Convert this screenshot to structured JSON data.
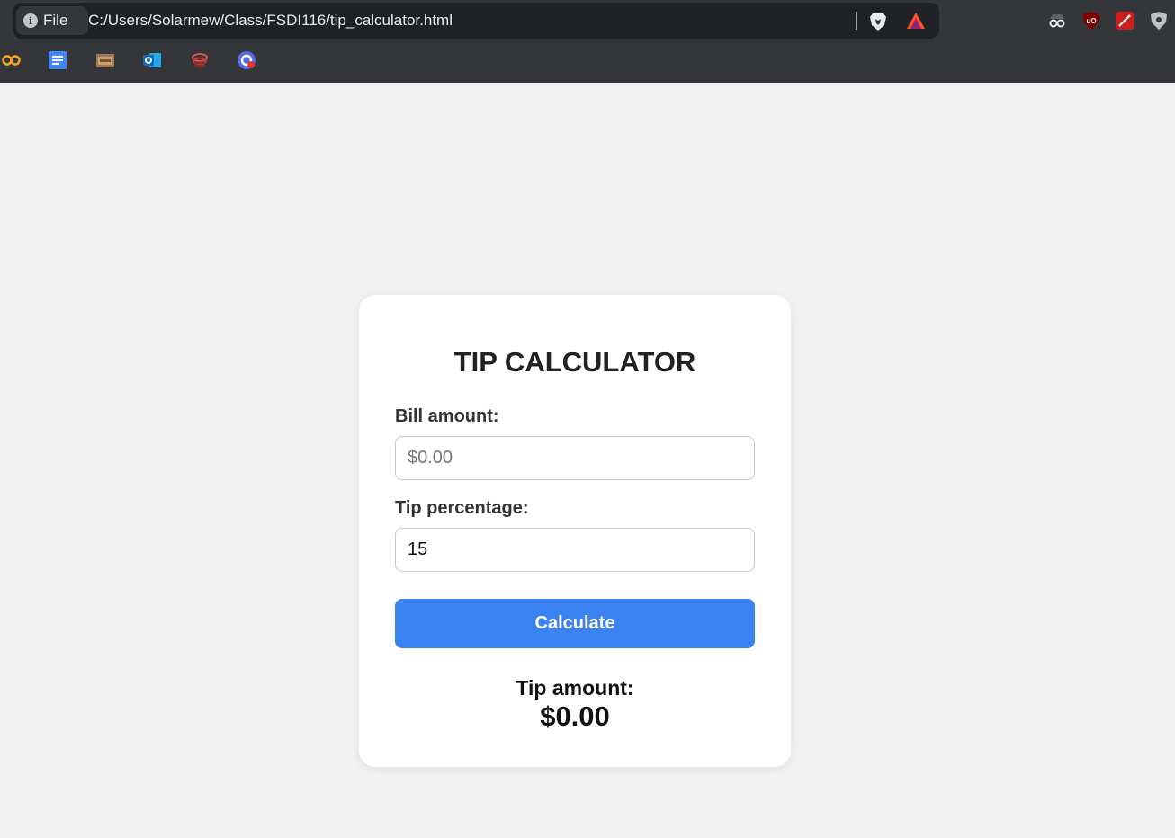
{
  "browser": {
    "site_chip_label": "File",
    "url": "C:/Users/Solarmew/Class/FSDI116/tip_calculator.html",
    "bookmarks": [
      "coursera-icon",
      "google-docs-icon",
      "lego-icon",
      "outlook-icon",
      "app-icon",
      "google-icon"
    ],
    "extensions": [
      "spy-icon",
      "ublock-icon",
      "magic-wand-icon",
      "shield-icon"
    ],
    "toolbar_color": "#35363a"
  },
  "calculator": {
    "title": "TIP CALCULATOR",
    "bill_label": "Bill amount:",
    "bill_placeholder": "$0.00",
    "bill_value": "",
    "tip_label": "Tip percentage:",
    "tip_value": "15",
    "calculate_label": "Calculate",
    "result_label": "Tip amount:",
    "result_value": "$0.00",
    "accent_color": "#3b82f2"
  }
}
